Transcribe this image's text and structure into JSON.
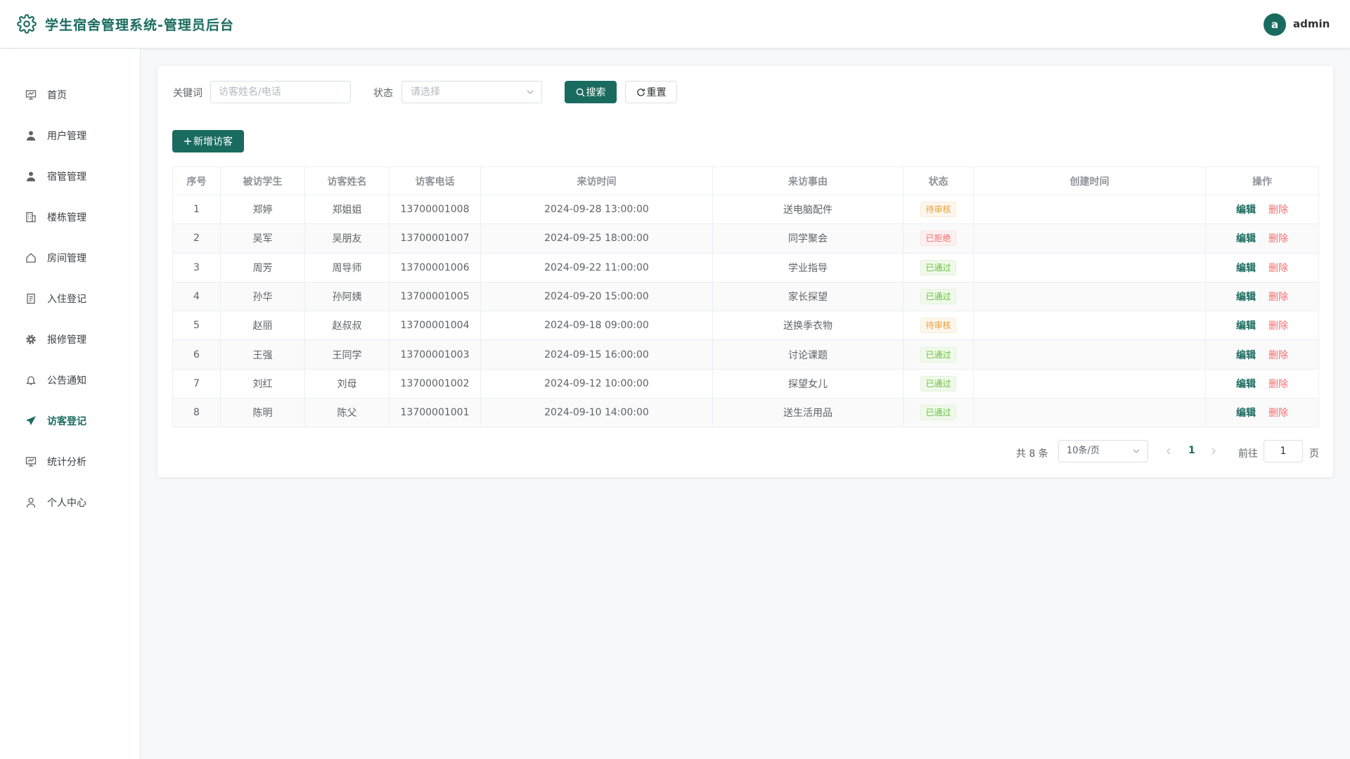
{
  "header": {
    "app_title": "学生宿舍管理系统-管理员后台",
    "avatar_letter": "a",
    "username": "admin",
    "accent_color": "#1a6b5f"
  },
  "sidebar": {
    "items": [
      {
        "label": "首页",
        "icon": "dashboard-icon"
      },
      {
        "label": "用户管理",
        "icon": "user-icon"
      },
      {
        "label": "宿管管理",
        "icon": "manager-icon"
      },
      {
        "label": "楼栋管理",
        "icon": "building-icon"
      },
      {
        "label": "房间管理",
        "icon": "house-icon"
      },
      {
        "label": "入住登记",
        "icon": "document-icon"
      },
      {
        "label": "报修管理",
        "icon": "gear-icon"
      },
      {
        "label": "公告通知",
        "icon": "bell-icon"
      },
      {
        "label": "访客登记",
        "icon": "send-icon",
        "active": true
      },
      {
        "label": "统计分析",
        "icon": "chart-icon"
      },
      {
        "label": "个人中心",
        "icon": "profile-icon"
      }
    ]
  },
  "filters": {
    "keyword_label": "关键词",
    "keyword_placeholder": "访客姓名/电话",
    "status_label": "状态",
    "status_placeholder": "请选择",
    "search_label": "搜索",
    "reset_label": "重置"
  },
  "toolbar": {
    "add_label": "新增访客"
  },
  "table": {
    "columns": [
      "序号",
      "被访学生",
      "访客姓名",
      "访客电话",
      "来访时间",
      "来访事由",
      "状态",
      "创建时间",
      "操作"
    ],
    "edit_label": "编辑",
    "delete_label": "删除",
    "rows": [
      {
        "no": "1",
        "student": "郑婷",
        "visitor": "郑姐姐",
        "phone": "13700001008",
        "time": "2024-09-28 13:00:00",
        "reason": "送电脑配件",
        "status": "待审核",
        "status_type": "warn",
        "created": ""
      },
      {
        "no": "2",
        "student": "吴军",
        "visitor": "吴朋友",
        "phone": "13700001007",
        "time": "2024-09-25 18:00:00",
        "reason": "同学聚会",
        "status": "已拒绝",
        "status_type": "danger",
        "created": ""
      },
      {
        "no": "3",
        "student": "周芳",
        "visitor": "周导师",
        "phone": "13700001006",
        "time": "2024-09-22 11:00:00",
        "reason": "学业指导",
        "status": "已通过",
        "status_type": "success",
        "created": ""
      },
      {
        "no": "4",
        "student": "孙华",
        "visitor": "孙阿姨",
        "phone": "13700001005",
        "time": "2024-09-20 15:00:00",
        "reason": "家长探望",
        "status": "已通过",
        "status_type": "success",
        "created": ""
      },
      {
        "no": "5",
        "student": "赵丽",
        "visitor": "赵叔叔",
        "phone": "13700001004",
        "time": "2024-09-18 09:00:00",
        "reason": "送换季衣物",
        "status": "待审核",
        "status_type": "warn",
        "created": ""
      },
      {
        "no": "6",
        "student": "王强",
        "visitor": "王同学",
        "phone": "13700001003",
        "time": "2024-09-15 16:00:00",
        "reason": "讨论课题",
        "status": "已通过",
        "status_type": "success",
        "created": ""
      },
      {
        "no": "7",
        "student": "刘红",
        "visitor": "刘母",
        "phone": "13700001002",
        "time": "2024-09-12 10:00:00",
        "reason": "探望女儿",
        "status": "已通过",
        "status_type": "success",
        "created": ""
      },
      {
        "no": "8",
        "student": "陈明",
        "visitor": "陈父",
        "phone": "13700001001",
        "time": "2024-09-10 14:00:00",
        "reason": "送生活用品",
        "status": "已通过",
        "status_type": "success",
        "created": ""
      }
    ]
  },
  "pagination": {
    "total_text": "共 8 条",
    "page_size": "10条/页",
    "current_page": "1",
    "goto_label": "前往",
    "goto_value": "1",
    "page_suffix": "页"
  }
}
